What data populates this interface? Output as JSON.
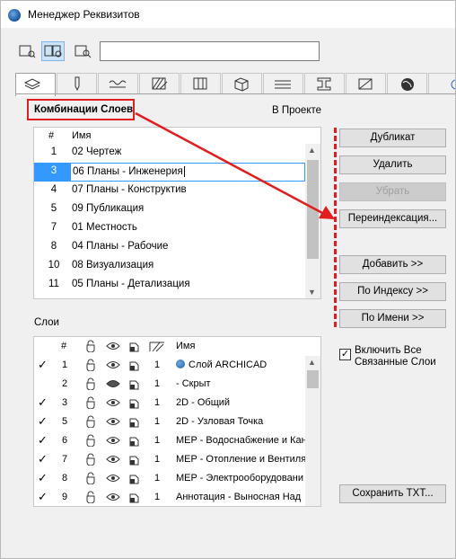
{
  "window": {
    "title": "Менеджер Реквизитов"
  },
  "search": {
    "value": "",
    "placeholder": ""
  },
  "combos": {
    "header": "Комбинации Слоев",
    "in_project": "В Проекте",
    "columns": {
      "num": "#",
      "name": "Имя"
    },
    "rows": [
      {
        "num": "1",
        "name": "02 Чертеж"
      },
      {
        "num": "3",
        "name": "06 Планы - Инженерия",
        "selected": true
      },
      {
        "num": "4",
        "name": "07 Планы - Конструктив"
      },
      {
        "num": "5",
        "name": "09 Публикация"
      },
      {
        "num": "7",
        "name": "01 Местность"
      },
      {
        "num": "8",
        "name": "04 Планы - Рабочие"
      },
      {
        "num": "10",
        "name": "08 Визуализация"
      },
      {
        "num": "11",
        "name": "05 Планы - Детализация"
      }
    ]
  },
  "buttons": {
    "duplicate": "Дубликат",
    "delete": "Удалить",
    "remove": "Убрать",
    "reindex": "Переиндексация...",
    "add": "Добавить >>",
    "by_index": "По Индексу >>",
    "by_name": "По Имени >>",
    "save_txt": "Сохранить TXT..."
  },
  "layers": {
    "label": "Слои",
    "columns": {
      "num": "#",
      "name": "Имя"
    },
    "rows": [
      {
        "checked": true,
        "num": "1",
        "pen": "1",
        "name": "Слой ARCHICAD",
        "hidden": false
      },
      {
        "checked": false,
        "num": "2",
        "pen": "1",
        "name": "- Скрыт",
        "hidden": true
      },
      {
        "checked": true,
        "num": "3",
        "pen": "1",
        "name": "2D - Общий",
        "hidden": false
      },
      {
        "checked": true,
        "num": "5",
        "pen": "1",
        "name": "2D - Узловая Точка",
        "hidden": false
      },
      {
        "checked": true,
        "num": "6",
        "pen": "1",
        "name": "MEP - Водоснабжение и Кан",
        "hidden": false
      },
      {
        "checked": true,
        "num": "7",
        "pen": "1",
        "name": "MEP - Отопление и Вентиля",
        "hidden": false
      },
      {
        "checked": true,
        "num": "8",
        "pen": "1",
        "name": "MEP - Электрооборудовани",
        "hidden": false
      },
      {
        "checked": true,
        "num": "9",
        "pen": "1",
        "name": "Аннотация - Выносная Над",
        "hidden": false
      }
    ]
  },
  "include_linked": {
    "label": "Включить Все Связанные Слои",
    "checked": true
  },
  "colors": {
    "highlight": "#e01e1e",
    "selection": "#3399ff"
  }
}
